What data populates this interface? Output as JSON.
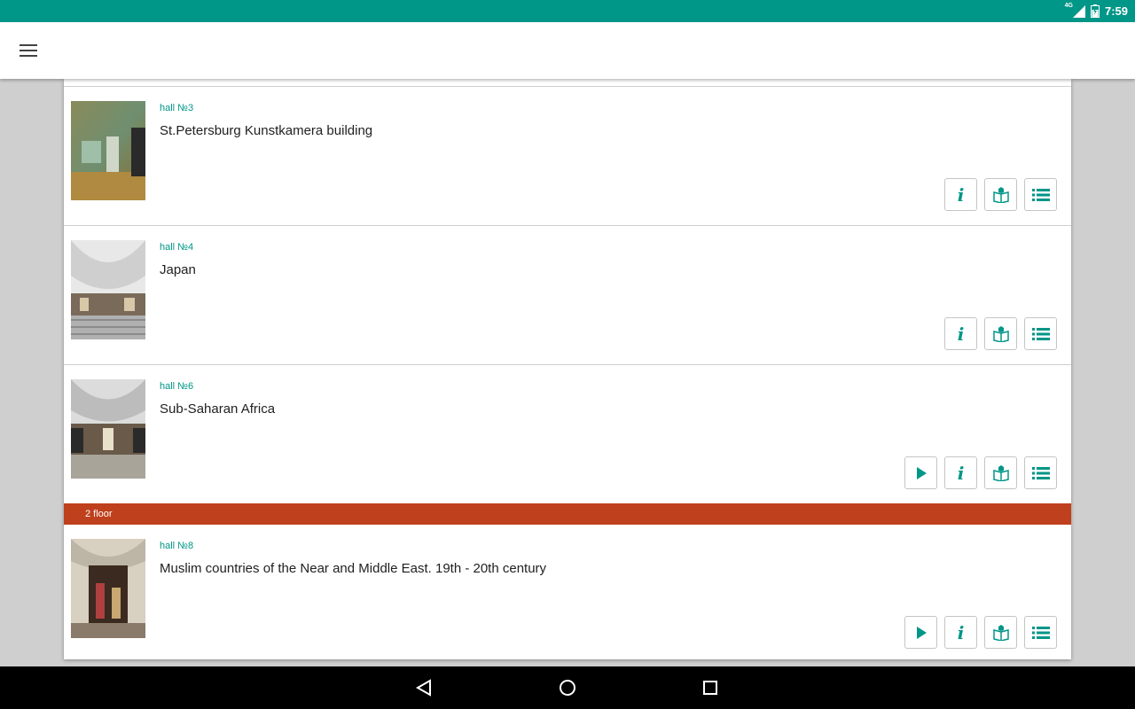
{
  "status_bar": {
    "network": "4G",
    "time": "7:59"
  },
  "app_bar": {
    "menu_icon": "hamburger-menu-icon"
  },
  "halls": [
    {
      "hall_no": "hall №3",
      "title": "St.Petersburg Kunstkamera building",
      "actions": [
        "info",
        "guide",
        "list"
      ]
    },
    {
      "hall_no": "hall №4",
      "title": "Japan",
      "actions": [
        "info",
        "guide",
        "list"
      ]
    },
    {
      "hall_no": "hall №6",
      "title": "Sub-Saharan Africa",
      "actions": [
        "play",
        "info",
        "guide",
        "list"
      ]
    },
    {
      "hall_no": "hall №8",
      "title": "Muslim countries of the Near and Middle East. 19th - 20th century",
      "actions": [
        "play",
        "info",
        "guide",
        "list"
      ]
    }
  ],
  "floor_header": {
    "label": "2 floor"
  },
  "icons": {
    "info": "i",
    "accent": "#009688",
    "floor_color": "#bf401c"
  },
  "nav_bar": {
    "items": [
      "back-icon",
      "home-icon",
      "recents-icon"
    ]
  }
}
